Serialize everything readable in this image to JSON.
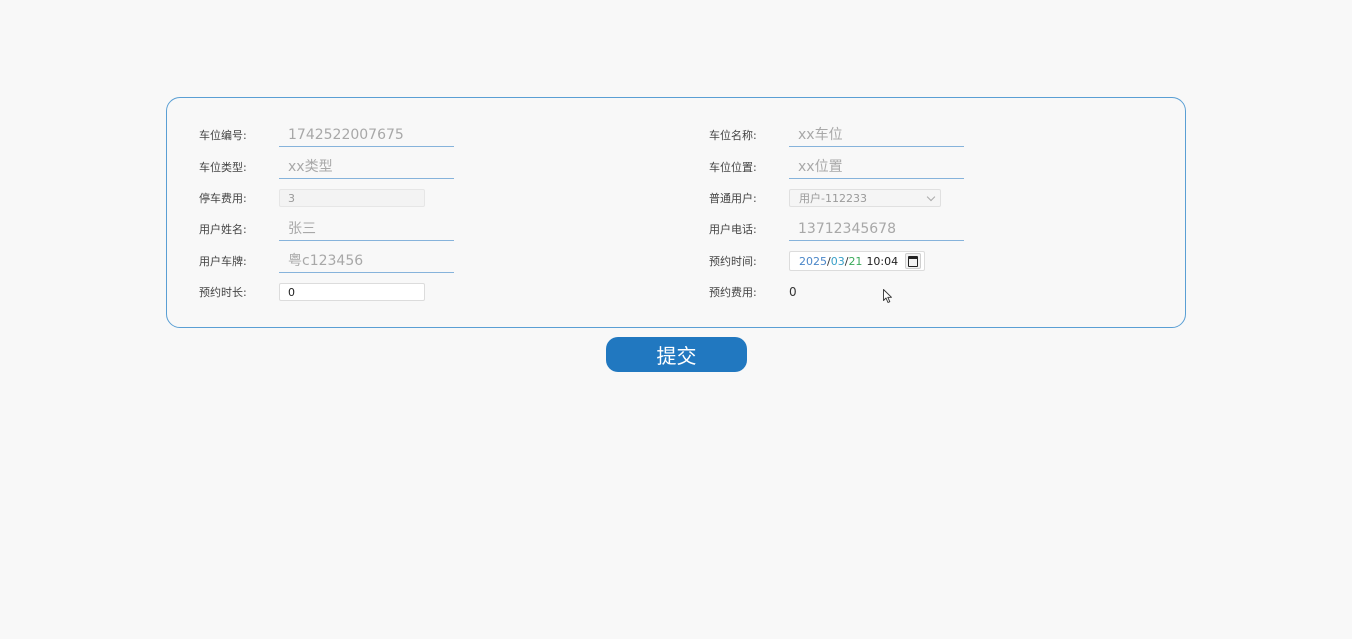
{
  "form": {
    "left": [
      {
        "label": "车位编号:",
        "kind": "underline",
        "value": "",
        "placeholder": "1742522007675"
      },
      {
        "label": "车位类型:",
        "kind": "underline",
        "value": "",
        "placeholder": "xx类型"
      },
      {
        "label": "停车费用:",
        "kind": "disabled",
        "value": "3"
      },
      {
        "label": "用户姓名:",
        "kind": "underline",
        "value": "",
        "placeholder": "张三"
      },
      {
        "label": "用户车牌:",
        "kind": "underline",
        "value": "",
        "placeholder": "粤c123456"
      },
      {
        "label": "预约时长:",
        "kind": "box",
        "value": "0"
      }
    ],
    "right": [
      {
        "label": "车位名称:",
        "kind": "underline",
        "value": "",
        "placeholder": "xx车位"
      },
      {
        "label": "车位位置:",
        "kind": "underline",
        "value": "",
        "placeholder": "xx位置"
      },
      {
        "label": "普通用户:",
        "kind": "select",
        "value": "用户-112233"
      },
      {
        "label": "用户电话:",
        "kind": "underline",
        "value": "",
        "placeholder": "13712345678"
      },
      {
        "label": "预约时间:",
        "kind": "datetime",
        "year": "2025",
        "month": "03",
        "day": "21",
        "time": "10:04",
        "sep": "/"
      },
      {
        "label": "预约费用:",
        "kind": "text",
        "value": "0"
      }
    ]
  },
  "submit": {
    "label": "提交"
  },
  "colors": {
    "panel_border": "#5a9fd4",
    "button_bg": "#2178c0",
    "underline": "#86b3db"
  },
  "icons": {
    "calendar": "calendar-icon",
    "select_arrow": "chevron-down-icon",
    "cursor": "mouse-cursor-icon"
  }
}
